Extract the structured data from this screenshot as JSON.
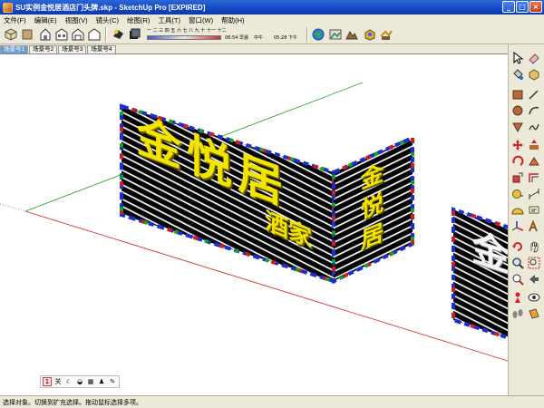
{
  "window": {
    "title": "SU实例金悦居酒店门头牌.skp - SketchUp Pro [EXPIRED]",
    "buttons": [
      "_",
      "□",
      "×"
    ]
  },
  "menu": [
    "文件(F)",
    "编辑(E)",
    "视图(V)",
    "镜头(C)",
    "绘图(R)",
    "工具(T)",
    "窗口(W)",
    "帮助(H)"
  ],
  "shadows": {
    "months": "一 二 三 四 五 六 七 八 九 十 十一 十二",
    "time_left": "06:54 早晨",
    "time_mid": "中午",
    "time_right": "05:28 下午"
  },
  "scene_tabs": [
    "场景号1",
    "场景号2",
    "场景号3",
    "场景号4"
  ],
  "active_scene_tab": 0,
  "viewport": {
    "sign_main_big": "金悦居",
    "sign_main_small": "酒家",
    "sign_side": [
      "金",
      "悦",
      "居"
    ],
    "sign_partial": "金",
    "axis_colors": {
      "red": "#d02020",
      "green": "#1aa01a",
      "blue": "#2030c0"
    },
    "border_colors": [
      "#1b2fd0",
      "#d41c1c",
      "#10a81a"
    ]
  },
  "mini_toolbar": [
    "1",
    "关",
    "☾",
    "◒",
    "▦",
    "♟",
    "✎"
  ],
  "tools": [
    "select-icon",
    "eraser-icon",
    "paint-bucket-icon",
    "make-component-icon",
    "rectangle-icon",
    "line-icon",
    "circle-icon",
    "arc-icon",
    "polygon-icon",
    "freehand-icon",
    "move-icon",
    "push-pull-icon",
    "rotate-icon",
    "follow-me-icon",
    "scale-icon",
    "offset-icon",
    "tape-measure-icon",
    "dimension-icon",
    "protractor-icon",
    "text-icon",
    "axes-icon",
    "3d-text-icon",
    "orbit-icon",
    "pan-icon",
    "zoom-icon",
    "zoom-window-icon",
    "zoom-extents-icon",
    "previous-view-icon",
    "position-camera-icon",
    "look-around-icon",
    "walk-icon",
    "section-plane-icon"
  ],
  "status": "选择对象。切换到扩充选择。拖动鼠标选择多项。"
}
